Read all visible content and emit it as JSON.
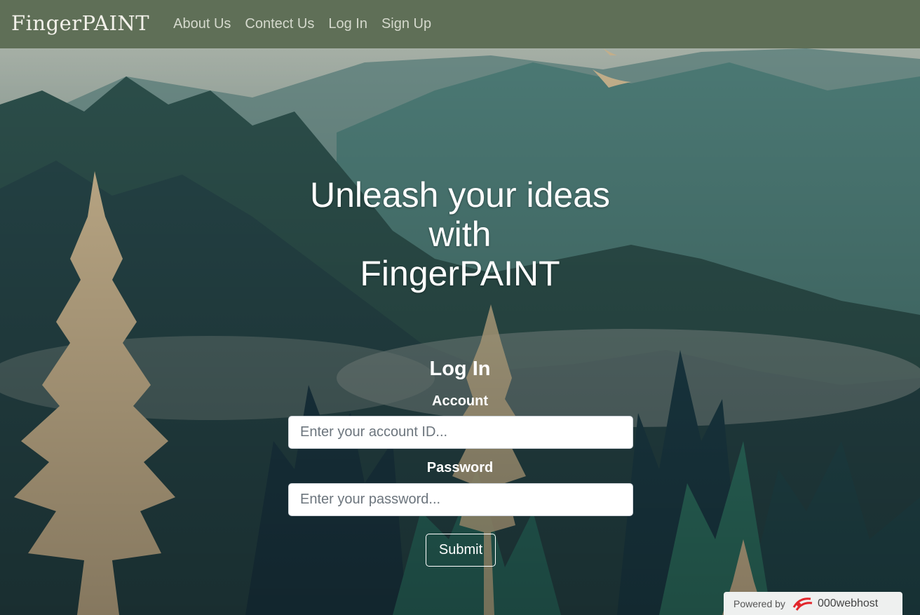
{
  "navbar": {
    "brand": "FingerPAINT",
    "links": [
      "About Us",
      "Contect Us",
      "Log In",
      "Sign Up"
    ]
  },
  "hero": {
    "line1": "Unleash your ideas",
    "line2": "with",
    "line3": "FingerPAINT"
  },
  "login": {
    "title": "Log In",
    "account_label": "Account",
    "account_placeholder": "Enter your account ID...",
    "password_label": "Password",
    "password_placeholder": "Enter your password...",
    "submit_label": "Submit"
  },
  "badge": {
    "prefix": "Powered by",
    "name": "000webhost"
  },
  "colors": {
    "navbar": "#5f6f57",
    "forest_dark": "#1f3b44",
    "forest_teal": "#2c6a63",
    "tree_gold": "#cdb892"
  }
}
